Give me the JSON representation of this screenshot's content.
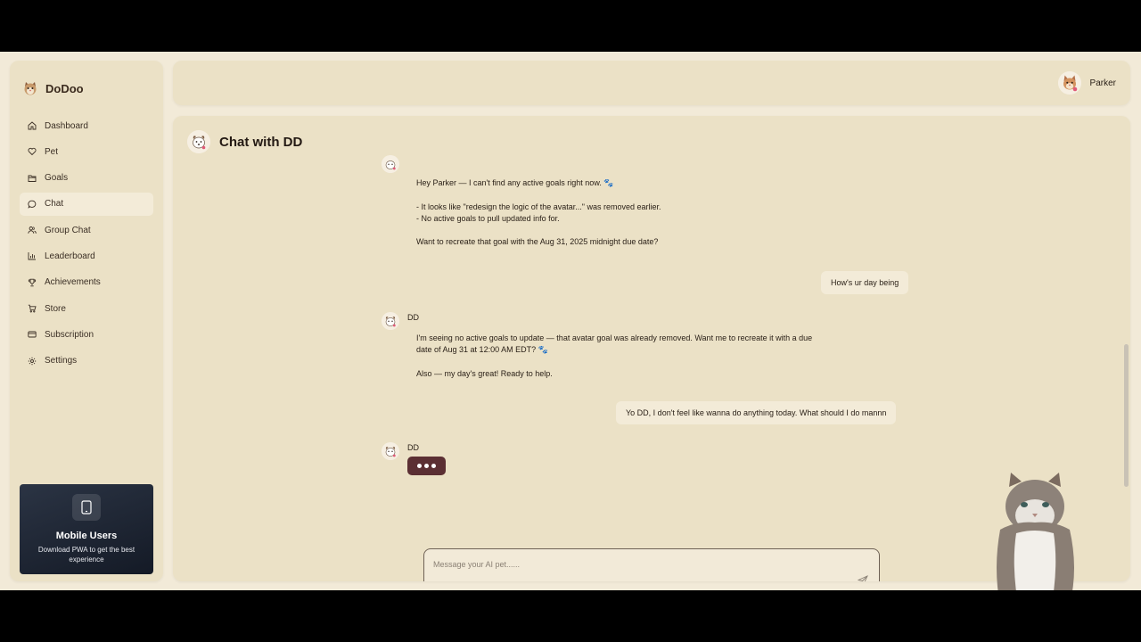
{
  "app": {
    "name": "DoDoo"
  },
  "sidebar": {
    "items": [
      {
        "label": "Dashboard",
        "icon": "home-icon"
      },
      {
        "label": "Pet",
        "icon": "heart-icon"
      },
      {
        "label": "Goals",
        "icon": "folder-icon"
      },
      {
        "label": "Chat",
        "icon": "chat-bubble-icon",
        "active": true
      },
      {
        "label": "Group Chat",
        "icon": "users-icon"
      },
      {
        "label": "Leaderboard",
        "icon": "bar-chart-icon"
      },
      {
        "label": "Achievements",
        "icon": "trophy-icon"
      },
      {
        "label": "Store",
        "icon": "cart-icon"
      },
      {
        "label": "Subscription",
        "icon": "credit-card-icon"
      },
      {
        "label": "Settings",
        "icon": "gear-icon"
      }
    ],
    "promo": {
      "title": "Mobile Users",
      "subtitle": "Download PWA to get the best experience",
      "icon": "smartphone-icon"
    }
  },
  "header": {
    "user_name": "Parker"
  },
  "chat": {
    "title": "Chat with DD",
    "bot_name": "DD",
    "messages": [
      {
        "role": "bot",
        "lines": [
          "Hey Parker — I can't find any active goals right now. 🐾",
          "",
          "- It looks like \"redesign the logic of the avatar...\" was removed earlier.",
          "- No active goals to pull updated info for.",
          "",
          "Want to recreate that goal with the Aug 31, 2025 midnight due date?"
        ]
      },
      {
        "role": "user",
        "text": "How's ur day being"
      },
      {
        "role": "bot",
        "lines": [
          "I'm seeing no active goals to update — that avatar goal was already removed. Want me to recreate it with a due",
          "date of Aug 31 at 12:00 AM EDT? 🐾",
          "",
          "Also — my day's great! Ready to help."
        ]
      },
      {
        "role": "user",
        "text": "Yo DD, I don't feel like wanna do anything today. What should I do mannn"
      },
      {
        "role": "bot",
        "typing": true
      }
    ],
    "input_placeholder": "Message your AI pet......",
    "send_icon": "send-icon"
  },
  "colors": {
    "page_bg": "#f2ead8",
    "panel_bg": "#ebe1c6",
    "active_nav": "#f3ebd8",
    "typing_indicator": "#5b2f33",
    "promo_bg": "#1a2130"
  }
}
